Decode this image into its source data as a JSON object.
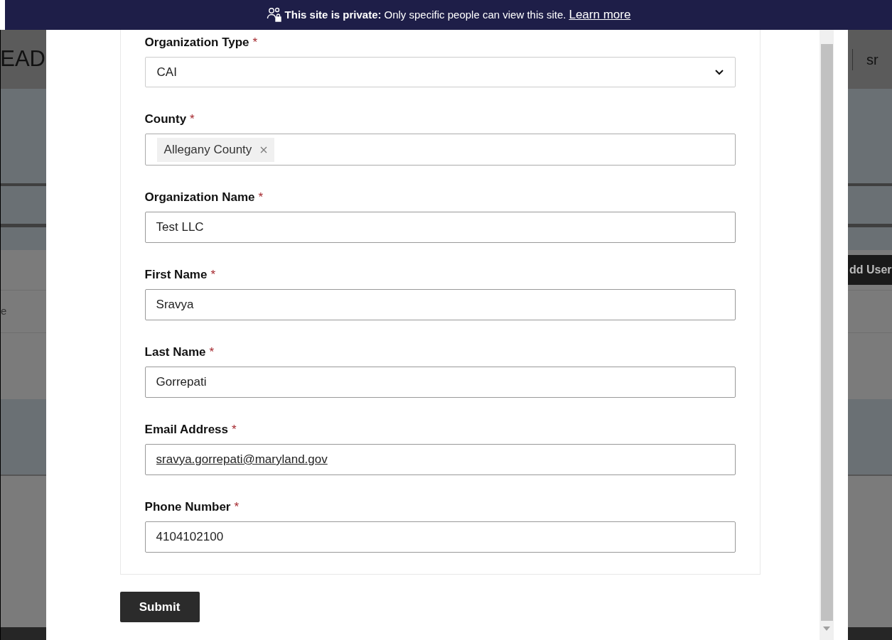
{
  "banner": {
    "title": "This site is private:",
    "text": "Only specific people can view this site.",
    "link": "Learn more"
  },
  "background": {
    "heading": "EAD",
    "user": "sr",
    "add_button": "dd User",
    "cell": "e"
  },
  "form": {
    "required_mark": "*",
    "fields": [
      {
        "kind": "select",
        "label": "Organization Type",
        "required": true,
        "value": "CAI"
      },
      {
        "kind": "tags",
        "label": "County",
        "required": true,
        "tags": [
          "Allegany County"
        ]
      },
      {
        "kind": "text",
        "label": "Organization Name",
        "required": true,
        "value": "Test LLC"
      },
      {
        "kind": "text",
        "label": "First Name",
        "required": true,
        "value": "Sravya"
      },
      {
        "kind": "text",
        "label": "Last Name",
        "required": true,
        "value": "Gorrepati"
      },
      {
        "kind": "email",
        "label": "Email Address",
        "required": true,
        "value": "sravya.gorrepati@maryland.gov"
      },
      {
        "kind": "text",
        "label": "Phone Number",
        "required": true,
        "value": "4104102100"
      }
    ],
    "submit": "Submit"
  }
}
